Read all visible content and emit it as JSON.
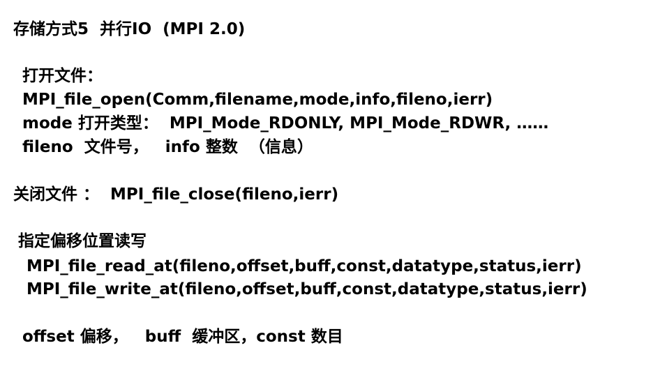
{
  "slide": {
    "title": "存储方式5  并行IO  (MPI 2.0)",
    "open_heading": "打开文件：",
    "open_call": "MPI_file_open(Comm,filename,mode,info,fileno,ierr)",
    "mode_line": "mode 打开类型：  MPI_Mode_RDONLY, MPI_Mode_RDWR, ……",
    "fileno_line": "fileno  文件号，   info 整数  （信息）",
    "close_line": "关闭文件 ：  MPI_file_close(fileno,ierr)",
    "offset_heading": "指定偏移位置读写",
    "read_call": "MPI_file_read_at(fileno,offset,buff,const,datatype,status,ierr)",
    "write_call": "MPI_file_write_at(fileno,offset,buff,const,datatype,status,ierr)",
    "params_line": "offset 偏移，   buff  缓冲区，const 数目"
  }
}
